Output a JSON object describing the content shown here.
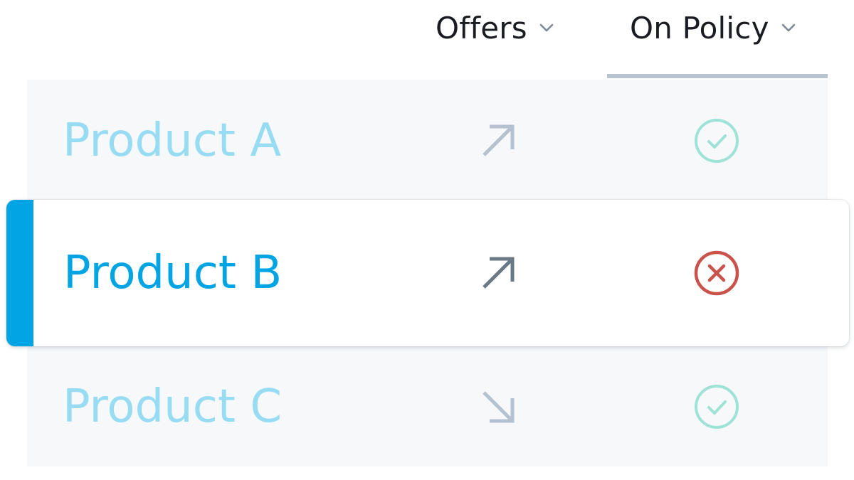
{
  "header": {
    "columns": [
      {
        "label": "Offers",
        "icon": "chevron-down-icon"
      },
      {
        "label": "On Policy",
        "icon": "chevron-down-icon",
        "sorted": true
      }
    ]
  },
  "rows": [
    {
      "label": "Product A",
      "offer_trend": "up-right-arrow-icon",
      "on_policy": "check-circle-icon",
      "selected": false
    },
    {
      "label": "Product B",
      "offer_trend": "up-right-arrow-icon",
      "on_policy": "x-circle-icon",
      "selected": true
    },
    {
      "label": "Product C",
      "offer_trend": "down-right-arrow-icon",
      "on_policy": "check-circle-icon",
      "selected": false
    }
  ],
  "colors": {
    "accent": "#02a4e3",
    "label_dim": "#97dcf3",
    "arrow_dim": "#b5c1cf",
    "arrow_active": "#6b7886",
    "check_dim": "#9fe2d6",
    "error": "#c9534a",
    "table_bg": "#f6f8fa",
    "sort_indicator": "#b9c3d0"
  }
}
